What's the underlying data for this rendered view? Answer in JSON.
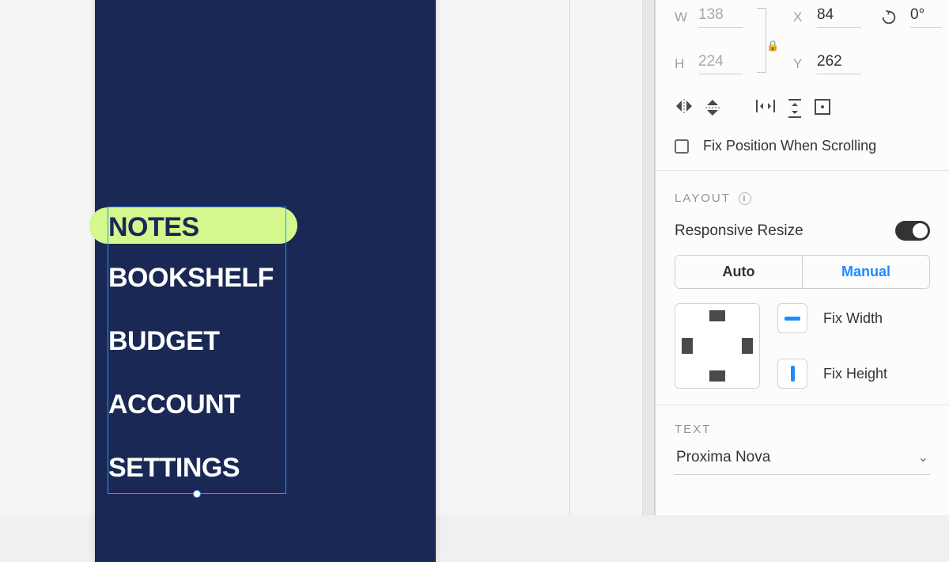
{
  "canvas": {
    "artboard_bg": "#1a2855",
    "highlight_bg": "#d4f78e",
    "menu_items": [
      "NOTES",
      "BOOKSHELF",
      "BUDGET",
      "ACCOUNT",
      "SETTINGS"
    ]
  },
  "inspector": {
    "position": {
      "w_label": "W",
      "w_value": "138",
      "h_label": "H",
      "h_value": "224",
      "x_label": "X",
      "x_value": "84",
      "y_label": "Y",
      "y_value": "262",
      "rotation_value": "0°"
    },
    "fix_position_label": "Fix Position When Scrolling",
    "layout": {
      "header": "LAYOUT",
      "responsive_label": "Responsive Resize",
      "auto_label": "Auto",
      "manual_label": "Manual",
      "fix_width_label": "Fix Width",
      "fix_height_label": "Fix Height"
    },
    "text": {
      "header": "TEXT",
      "font_name": "Proxima Nova"
    }
  }
}
